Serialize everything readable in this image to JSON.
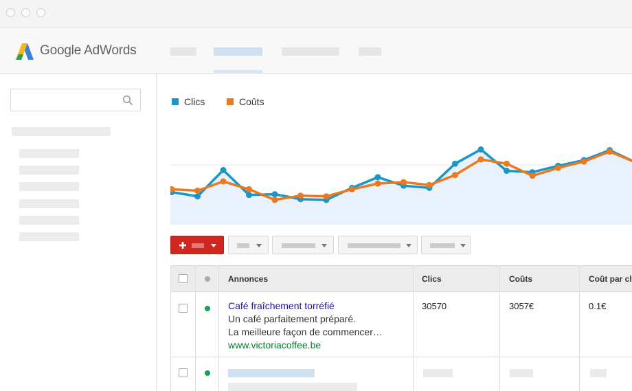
{
  "app": {
    "logo_text": "Google AdWords",
    "logo_icon": "adwords-logo-icon"
  },
  "legend": [
    {
      "label": "Clics",
      "color": "#1a96c9"
    },
    {
      "label": "Coûts",
      "color": "#ea7a1d"
    }
  ],
  "chart_data": {
    "type": "line",
    "x": [
      1,
      2,
      3,
      4,
      5,
      6,
      7,
      8,
      9,
      10,
      11,
      12,
      13,
      14,
      15,
      16,
      17,
      18,
      19,
      20,
      21,
      22,
      23,
      24
    ],
    "series": [
      {
        "name": "Clics",
        "color": "#1a96c9",
        "values": [
          44,
          38,
          75,
          40,
          41,
          34,
          33,
          50,
          65,
          53,
          50,
          84,
          104,
          74,
          72,
          81,
          89,
          103,
          86,
          91,
          82,
          103,
          97,
          84
        ]
      },
      {
        "name": "Coûts",
        "color": "#ea7a1d",
        "values": [
          48,
          46,
          59,
          48,
          33,
          39,
          38,
          48,
          56,
          58,
          54,
          68,
          90,
          84,
          67,
          78,
          87,
          101,
          86,
          91,
          82,
          103,
          97,
          84
        ]
      }
    ],
    "ylim": [
      0,
      120
    ],
    "grid": true,
    "fill_color": "#e8f1fc"
  },
  "toolbar": {
    "add_icon": "plus-icon",
    "dropdown_icon": "caret-down-icon"
  },
  "table": {
    "columns": [
      "Annonces",
      "Clics",
      "Coûts",
      "Coût par cl"
    ],
    "rows": [
      {
        "ad_title": "Café fraîchement torréfié",
        "ad_line1": "Un café parfaitement préparé.",
        "ad_line2": "La meilleure façon de commencer…",
        "ad_url": "www.victoriacoffee.be",
        "clics": "30570",
        "couts": "3057€",
        "cout_par_clic": "0.1€",
        "status_color": "#1e9e4a"
      }
    ]
  },
  "search": {
    "icon": "search-icon"
  }
}
